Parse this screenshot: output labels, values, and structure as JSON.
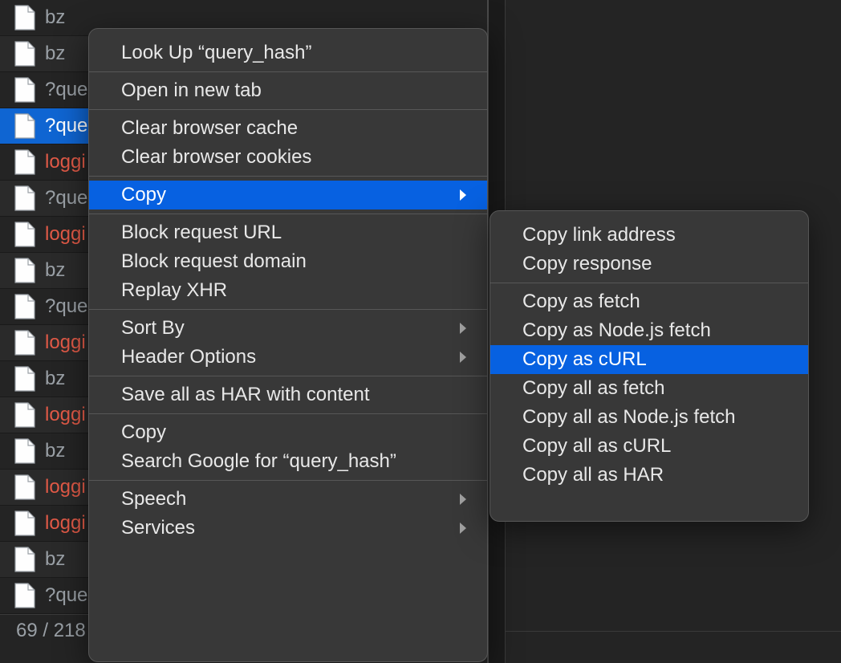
{
  "network": {
    "rows": [
      {
        "label": "bz",
        "color": "normal",
        "alt": false,
        "selected": false
      },
      {
        "label": "bz",
        "color": "normal",
        "alt": true,
        "selected": false
      },
      {
        "label": "?que",
        "color": "normal",
        "alt": false,
        "selected": false
      },
      {
        "label": "?que",
        "color": "normal",
        "alt": true,
        "selected": true
      },
      {
        "label": "loggi",
        "color": "red",
        "alt": false,
        "selected": false
      },
      {
        "label": "?que",
        "color": "normal",
        "alt": true,
        "selected": false
      },
      {
        "label": "loggi",
        "color": "red",
        "alt": false,
        "selected": false
      },
      {
        "label": "bz",
        "color": "normal",
        "alt": true,
        "selected": false
      },
      {
        "label": "?que",
        "color": "normal",
        "alt": false,
        "selected": false
      },
      {
        "label": "loggi",
        "color": "red",
        "alt": true,
        "selected": false
      },
      {
        "label": "bz",
        "color": "normal",
        "alt": false,
        "selected": false
      },
      {
        "label": "loggi",
        "color": "red",
        "alt": true,
        "selected": false
      },
      {
        "label": "bz",
        "color": "normal",
        "alt": false,
        "selected": false
      },
      {
        "label": "loggi",
        "color": "red",
        "alt": true,
        "selected": false
      },
      {
        "label": "loggi",
        "color": "red",
        "alt": false,
        "selected": false
      },
      {
        "label": "bz",
        "color": "normal",
        "alt": true,
        "selected": false
      },
      {
        "label": "?que",
        "color": "normal",
        "alt": false,
        "selected": false
      }
    ],
    "status": "69 / 218"
  },
  "contextMenu": {
    "groups": [
      [
        {
          "label": "Look Up “query_hash”",
          "submenu": false
        }
      ],
      [
        {
          "label": "Open in new tab",
          "submenu": false
        }
      ],
      [
        {
          "label": "Clear browser cache",
          "submenu": false
        },
        {
          "label": "Clear browser cookies",
          "submenu": false
        }
      ],
      [
        {
          "label": "Copy",
          "submenu": true,
          "highlight": true
        }
      ],
      [
        {
          "label": "Block request URL",
          "submenu": false
        },
        {
          "label": "Block request domain",
          "submenu": false
        },
        {
          "label": "Replay XHR",
          "submenu": false
        }
      ],
      [
        {
          "label": "Sort By",
          "submenu": true
        },
        {
          "label": "Header Options",
          "submenu": true
        }
      ],
      [
        {
          "label": "Save all as HAR with content",
          "submenu": false
        }
      ],
      [
        {
          "label": "Copy",
          "submenu": false
        },
        {
          "label": "Search Google for “query_hash”",
          "submenu": false
        }
      ],
      [
        {
          "label": "Speech",
          "submenu": true
        },
        {
          "label": "Services",
          "submenu": true
        }
      ]
    ]
  },
  "submenu": {
    "groups": [
      [
        {
          "label": "Copy link address"
        },
        {
          "label": "Copy response"
        }
      ],
      [
        {
          "label": "Copy as fetch"
        },
        {
          "label": "Copy as Node.js fetch"
        },
        {
          "label": "Copy as cURL",
          "highlight": true
        },
        {
          "label": "Copy all as fetch"
        },
        {
          "label": "Copy all as Node.js fetch"
        },
        {
          "label": "Copy all as cURL"
        },
        {
          "label": "Copy all as HAR"
        }
      ]
    ]
  }
}
